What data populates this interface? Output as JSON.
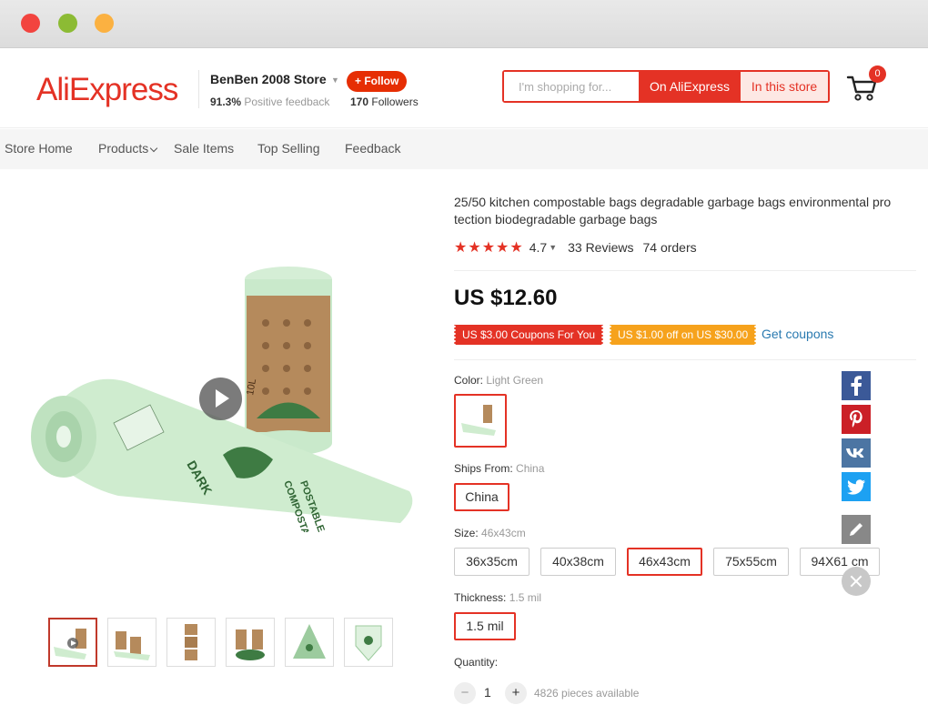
{
  "store": {
    "logo": "AliExpress",
    "name": "BenBen 2008 Store",
    "follow_label": "+ Follow",
    "feedback_pct": "91.3%",
    "feedback_label": "Positive feedback",
    "followers_count": "170",
    "followers_label": "Followers"
  },
  "search": {
    "placeholder": "I'm shopping for...",
    "btn_aliexpress": "On AliExpress",
    "btn_store": "In this store"
  },
  "cart": {
    "count": "0"
  },
  "nav": {
    "items": [
      "Store Home",
      "Products",
      "Sale Items",
      "Top Selling",
      "Feedback"
    ]
  },
  "product": {
    "title": "25/50 kitchen compostable bags degradable garbage bags environmental pro tection biodegradable garbage bags",
    "stars": "★★★★★",
    "rating": "4.7",
    "reviews": "33 Reviews",
    "orders": "74 orders",
    "price": "US $12.60",
    "coupon1": "US $3.00 Coupons For You",
    "coupon2": "US $1.00 off on US $30.00",
    "get_coupons": "Get coupons",
    "image_text": {
      "brand": "DARK",
      "print1": "POSTABLE",
      "print2": "COMPOSTABLE",
      "roll_label": "10L"
    }
  },
  "options": {
    "color_label": "Color:",
    "color_value": "Light Green",
    "ships_label": "Ships From:",
    "ships_value": "China",
    "ships_options": [
      "China"
    ],
    "size_label": "Size:",
    "size_value": "46x43cm",
    "size_options": [
      "36x35cm",
      "40x38cm",
      "46x43cm",
      "75x55cm",
      "94X61 cm"
    ],
    "thickness_label": "Thickness:",
    "thickness_value": "1.5 mil",
    "thickness_options": [
      "1.5 mil"
    ],
    "quantity_label": "Quantity:",
    "quantity_value": "1",
    "minus": "−",
    "plus": "+",
    "available": "4826 pieces available"
  },
  "share": {
    "fb": "f",
    "pin": "P",
    "vk": "vk",
    "tw": "t",
    "edit": "✎"
  },
  "colors": {
    "brand_red": "#e43225",
    "coupon_orange": "#f6a21c",
    "link_blue": "#2a7ab0",
    "bag_green": "#c6e8c8"
  }
}
